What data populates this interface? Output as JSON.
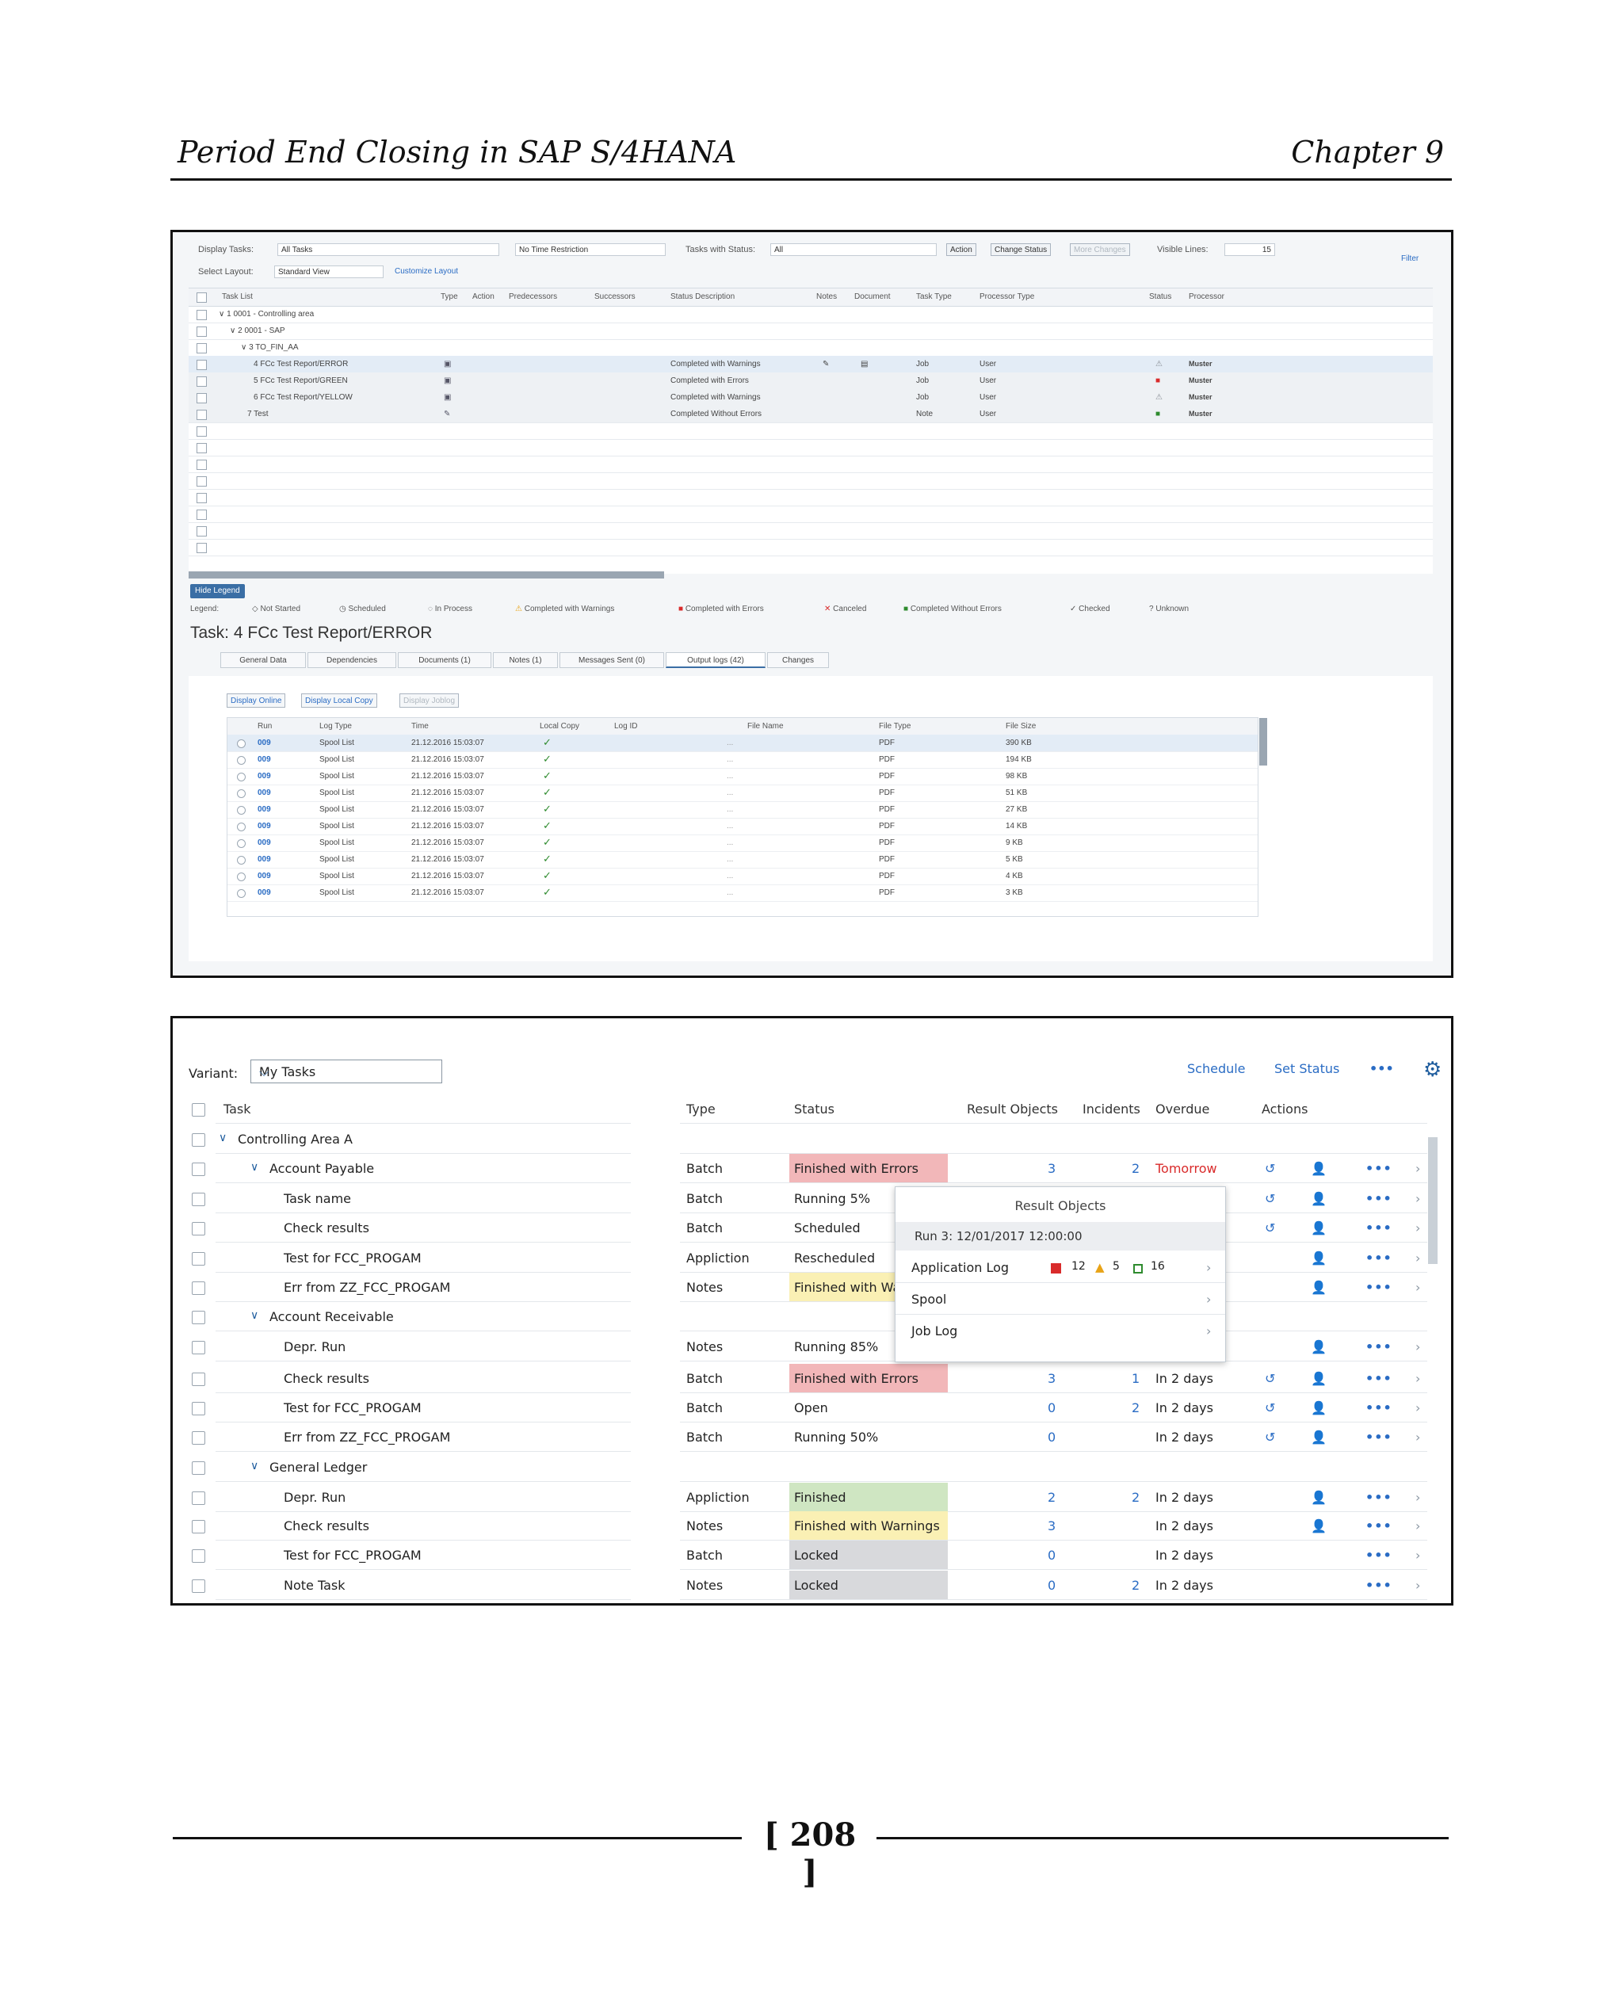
{
  "header": {
    "left": "Period End Closing in SAP S/4HANA",
    "right": "Chapter 9"
  },
  "footer": {
    "page": "[ 208 ]"
  },
  "shot1": {
    "toolbar": {
      "display_tasks_label": "Display Tasks:",
      "display_tasks_value": "All Tasks",
      "time_restriction": "No Time Restriction",
      "tasks_with_status_label": "Tasks with Status:",
      "tasks_with_status_value": "All",
      "action_btn": "Action",
      "change_status_btn": "Change Status",
      "more_changes_btn": "More Changes",
      "visible_lines_label": "Visible Lines:",
      "visible_lines_value": "15",
      "filter_link": "Filter",
      "select_layout_label": "Select Layout:",
      "select_layout_value": "Standard View",
      "customize_link": "Customize Layout"
    },
    "columns": [
      "Task List",
      "Type",
      "Action",
      "Predecessors",
      "Successors",
      "Status Description",
      "Notes",
      "Document",
      "Task Type",
      "Processor Type",
      "Status",
      "Processor"
    ],
    "rows": [
      {
        "task": "∨ 1 0001 - Controlling area",
        "type": "",
        "status_desc": "",
        "notes": "",
        "document": "",
        "task_type": "",
        "proc_type": "",
        "status": "",
        "processor": ""
      },
      {
        "task": "∨ 2 0001 - SAP",
        "type": "",
        "status_desc": "",
        "notes": "",
        "document": "",
        "task_type": "",
        "proc_type": "",
        "status": "",
        "processor": ""
      },
      {
        "task": "∨ 3 TO_FIN_AA",
        "type": "",
        "status_desc": "",
        "notes": "",
        "document": "",
        "task_type": "",
        "proc_type": "",
        "status": "",
        "processor": ""
      },
      {
        "task": "4 FCc Test Report/ERROR",
        "type": "▣",
        "status_desc": "Completed with Warnings",
        "notes": "✎",
        "document": "▤",
        "task_type": "Job",
        "proc_type": "User",
        "status": "⚠",
        "processor": "Muster"
      },
      {
        "task": "5 FCc Test Report/GREEN",
        "type": "▣",
        "status_desc": "Completed with Errors",
        "notes": "",
        "document": "",
        "task_type": "Job",
        "proc_type": "User",
        "status": "■",
        "processor": "Muster"
      },
      {
        "task": "6 FCc Test Report/YELLOW",
        "type": "▣",
        "status_desc": "Completed with Warnings",
        "notes": "",
        "document": "",
        "task_type": "Job",
        "proc_type": "User",
        "status": "⚠",
        "processor": "Muster"
      },
      {
        "task": "7 Test",
        "type": "✎",
        "status_desc": "Completed Without Errors",
        "notes": "",
        "document": "",
        "task_type": "Note",
        "proc_type": "User",
        "status": "■",
        "processor": "Muster"
      }
    ],
    "hide_legend": "Hide Legend",
    "legend_label": "Legend:",
    "legend": [
      "Not Started",
      "Scheduled",
      "In Process",
      "Completed with Warnings",
      "Completed with Errors",
      "Canceled",
      "Completed Without Errors",
      "Checked",
      "Unknown"
    ],
    "task_title": "Task: 4 FCc Test Report/ERROR",
    "tabs": [
      "General Data",
      "Dependencies",
      "Documents (1)",
      "Notes (1)",
      "Messages Sent (0)",
      "Output logs (42)",
      "Changes"
    ],
    "panel_buttons": [
      "Display Online",
      "Display Local Copy",
      "Display Joblog"
    ],
    "out_columns": [
      "Run",
      "Log Type",
      "Time",
      "Local Copy",
      "Log ID",
      "File Name",
      "File Type",
      "File Size"
    ],
    "out_rows": [
      {
        "run": "009",
        "log_type": "Spool List",
        "time": "21.12.2016 15:03:07",
        "file_type": "PDF",
        "file_size": "390 KB"
      },
      {
        "run": "009",
        "log_type": "Spool List",
        "time": "21.12.2016 15:03:07",
        "file_type": "PDF",
        "file_size": "194 KB"
      },
      {
        "run": "009",
        "log_type": "Spool List",
        "time": "21.12.2016 15:03:07",
        "file_type": "PDF",
        "file_size": "98 KB"
      },
      {
        "run": "009",
        "log_type": "Spool List",
        "time": "21.12.2016 15:03:07",
        "file_type": "PDF",
        "file_size": "51 KB"
      },
      {
        "run": "009",
        "log_type": "Spool List",
        "time": "21.12.2016 15:03:07",
        "file_type": "PDF",
        "file_size": "27 KB"
      },
      {
        "run": "009",
        "log_type": "Spool List",
        "time": "21.12.2016 15:03:07",
        "file_type": "PDF",
        "file_size": "14 KB"
      },
      {
        "run": "009",
        "log_type": "Spool List",
        "time": "21.12.2016 15:03:07",
        "file_type": "PDF",
        "file_size": "9 KB"
      },
      {
        "run": "009",
        "log_type": "Spool List",
        "time": "21.12.2016 15:03:07",
        "file_type": "PDF",
        "file_size": "5 KB"
      },
      {
        "run": "009",
        "log_type": "Spool List",
        "time": "21.12.2016 15:03:07",
        "file_type": "PDF",
        "file_size": "4 KB"
      },
      {
        "run": "009",
        "log_type": "Spool List",
        "time": "21.12.2016 15:03:07",
        "file_type": "PDF",
        "file_size": "3 KB"
      }
    ],
    "file_name_placeholder": "..."
  },
  "shot2": {
    "variant_label": "Variant:",
    "variant_value": "My Tasks",
    "schedule": "Schedule",
    "set_status": "Set Status",
    "more": "•••",
    "columns": {
      "task": "Task",
      "type": "Type",
      "status": "Status",
      "result_objects": "Result Objects",
      "incidents": "Incidents",
      "overdue": "Overdue",
      "actions": "Actions"
    },
    "rows": [
      {
        "task": "Controlling Area A",
        "level": 0,
        "group": true
      },
      {
        "task": "Account Payable",
        "level": 1,
        "group": true,
        "type": "Batch",
        "status": "Finished with Errors",
        "status_kind": "err",
        "result": "3",
        "incidents": "2",
        "overdue": "Tomorrow",
        "overdue_red": true,
        "log": true
      },
      {
        "task": "Task name",
        "level": 2,
        "type": "Batch",
        "status": "Running 5%",
        "log": true
      },
      {
        "task": "Check results",
        "level": 2,
        "type": "Batch",
        "status": "Scheduled",
        "log": true
      },
      {
        "task": "Test for FCC_PROGAM",
        "level": 2,
        "type": "Appliction",
        "status": "Rescheduled"
      },
      {
        "task": "Err from ZZ_FCC_PROGAM",
        "level": 2,
        "type": "Notes",
        "status": "Finished with Warnings",
        "status_kind": "warn"
      },
      {
        "task": "Account Receivable",
        "level": 1,
        "group": true,
        "noactions": true
      },
      {
        "task": "Depr. Run",
        "level": 2,
        "type": "Notes",
        "status": "Running 85%"
      },
      {
        "task": "Check results",
        "level": 2,
        "type": "Batch",
        "status": "Finished with Errors",
        "status_kind": "err",
        "result": "3",
        "incidents": "1",
        "overdue": "In 2 days",
        "log": true
      },
      {
        "task": "Test for FCC_PROGAM",
        "level": 2,
        "type": "Batch",
        "status": "Open",
        "result": "0",
        "incidents": "2",
        "overdue": "In 2 days",
        "log": true
      },
      {
        "task": "Err from ZZ_FCC_PROGAM",
        "level": 2,
        "type": "Batch",
        "status": "Running 50%",
        "result": "0",
        "overdue": "In 2 days",
        "log": true
      },
      {
        "task": "General Ledger",
        "level": 1,
        "group": true,
        "noactions": true
      },
      {
        "task": "Depr. Run",
        "level": 2,
        "type": "Appliction",
        "status": "Finished",
        "status_kind": "ok",
        "result": "2",
        "incidents": "2",
        "overdue": "In 2 days"
      },
      {
        "task": "Check results",
        "level": 2,
        "type": "Notes",
        "status": "Finished with Warnings",
        "status_kind": "warn",
        "result": "3",
        "overdue": "In 2 days"
      },
      {
        "task": "Test for FCC_PROGAM",
        "level": 2,
        "type": "Batch",
        "status": "Locked",
        "status_kind": "lock",
        "result": "0",
        "overdue": "In 2 days",
        "noassign": true
      },
      {
        "task": "Note Task",
        "level": 2,
        "type": "Notes",
        "status": "Locked",
        "status_kind": "lock",
        "result": "0",
        "incidents": "2",
        "overdue": "In 2 days",
        "noassign": true
      }
    ],
    "popup": {
      "title": "Result Objects",
      "run": "Run 3: 12/01/2017 12:00:00",
      "app_log": "Application Log",
      "errors": "12",
      "warnings": "5",
      "success": "16",
      "spool": "Spool",
      "job_log": "Job Log"
    }
  }
}
